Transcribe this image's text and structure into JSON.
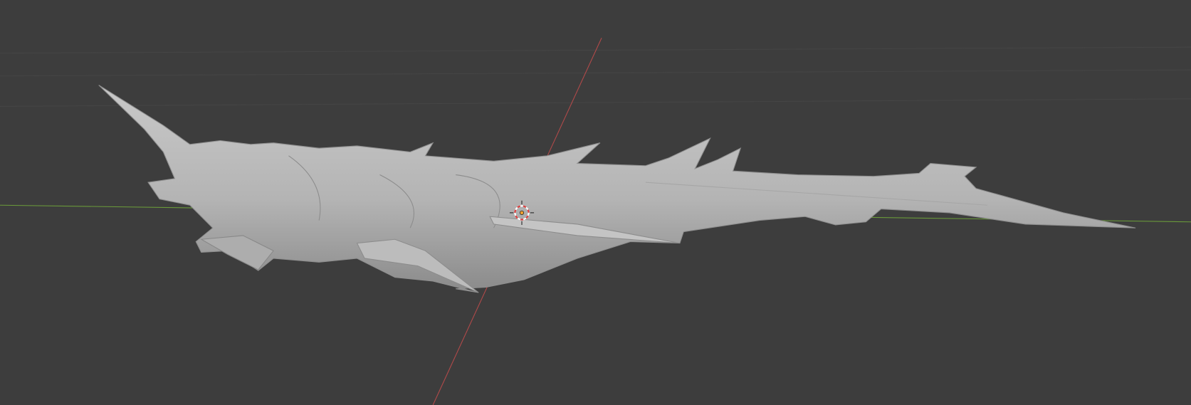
{
  "viewport": {
    "background_color": "#3d3d3d",
    "grid_color": "#474747",
    "x_axis_color": "#b34a4a",
    "y_axis_color": "#6a9a3a",
    "mesh_color": "#b8b8b8",
    "cursor_colors": [
      "#e04040",
      "#ffffff"
    ]
  }
}
